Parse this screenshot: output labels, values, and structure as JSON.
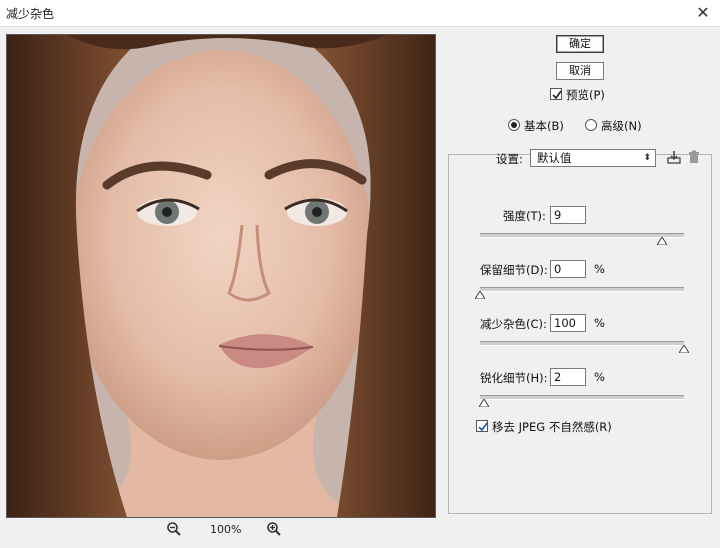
{
  "window": {
    "title": "减少杂色",
    "close_glyph": "✕"
  },
  "preview": {
    "zoom_level": "100%"
  },
  "buttons": {
    "ok": "确定",
    "cancel": "取消"
  },
  "preview_toggle": {
    "label": "预览(P)",
    "checked": true
  },
  "mode": {
    "basic": {
      "label": "基本(B)",
      "selected": true
    },
    "advanced": {
      "label": "高级(N)",
      "selected": false
    }
  },
  "settings": {
    "label": "设置:",
    "value": "默认值"
  },
  "controls": {
    "strength": {
      "label": "强度(T):",
      "value": "9",
      "unit": "",
      "level": 0.9
    },
    "preserve_details": {
      "label": "保留细节(D):",
      "value": "0",
      "unit": "%",
      "level": 0.0
    },
    "reduce_color_noise": {
      "label": "减少杂色(C):",
      "value": "100",
      "unit": "%",
      "level": 1.0
    },
    "sharpen_details": {
      "label": "锐化细节(H):",
      "value": "2",
      "unit": "%",
      "level": 0.02
    }
  },
  "jpeg_artifact": {
    "label": "移去 JPEG 不自然感(R)",
    "checked": true
  },
  "icons": [
    "zoom-out-icon",
    "zoom-in-icon",
    "save-preset-icon",
    "delete-preset-icon",
    "close-icon",
    "checkmark-icon"
  ]
}
